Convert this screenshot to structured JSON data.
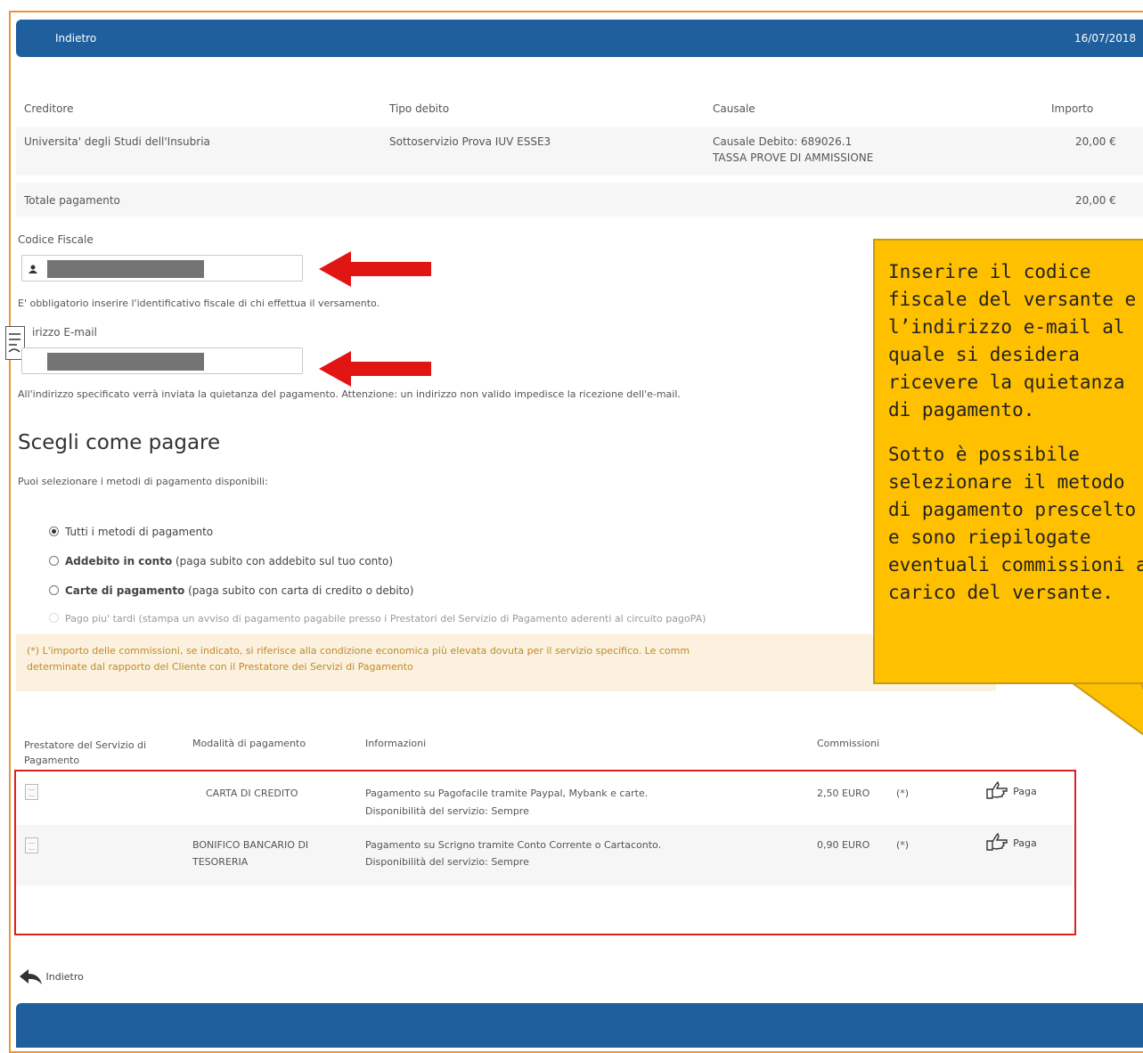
{
  "header": {
    "back_label": "Indietro",
    "date": "16/07/2018"
  },
  "debt_table": {
    "columns": [
      "Creditore",
      "Tipo debito",
      "Causale",
      "Importo"
    ],
    "row": {
      "creditor": "Universita' degli Studi dell'Insubria",
      "type": "Sottoservizio Prova IUV ESSE3",
      "causale_line1": "Causale Debito: 689026.1",
      "causale_line2": "TASSA PROVE DI AMMISSIONE",
      "amount": "20,00 €"
    },
    "total_label": "Totale pagamento",
    "total_amount": "20,00 €"
  },
  "form": {
    "fiscal_code_label": "Codice Fiscale",
    "fiscal_code_help": "E' obbligatorio inserire l'identificativo fiscale di chi effettua il versamento.",
    "email_label": "irizzo E-mail",
    "email_help": "All'indirizzo specificato verrà inviata la quietanza del pagamento. Attenzione: un indirizzo non valido impedisce la ricezione dell'e-mail."
  },
  "payment": {
    "title": "Scegli come pagare",
    "subtitle": "Puoi selezionare i metodi di pagamento disponibili:",
    "options": [
      {
        "bold": "Tutti i metodi di pagamento",
        "rest": "",
        "selected": true
      },
      {
        "bold": "Addebito in conto",
        "rest": " (paga subito con addebito sul tuo conto)",
        "selected": false
      },
      {
        "bold": "Carte di pagamento",
        "rest": " (paga subito con carta di credito o debito)",
        "selected": false
      },
      {
        "bold": "Pago piu' tardi",
        "rest": " (stampa un avviso di pagamento pagabile presso i Prestatori del Servizio di Pagamento aderenti al circuito pagoPA)",
        "selected": false
      }
    ],
    "note_line1": "(*) L'importo delle commissioni, se indicato, si riferisce alla condizione economica più elevata dovuta per il servizio specifico. Le comm",
    "note_line2": "determinate dal rapporto del Cliente con il Prestatore dei Servizi di Pagamento"
  },
  "methods_table": {
    "columns": [
      "Prestatore del Servizio di Pagamento",
      "Modalità di pagamento",
      "Informazioni",
      "Commissioni"
    ],
    "rows": [
      {
        "mode": "CARTA DI CREDITO",
        "info_line1": "Pagamento su Pagofacile tramite Paypal, Mybank e carte.",
        "info_line2": "Disponibilità del servizio: Sempre",
        "fee": "2,50 EURO",
        "fee_note": "(*)",
        "pay_label": "Paga"
      },
      {
        "mode_line1": "BONIFICO BANCARIO DI",
        "mode_line2": "TESORERIA",
        "info_line1": "Pagamento su Scrigno tramite Conto Corrente o Cartaconto.",
        "info_line2": "Disponibilità del servizio: Sempre",
        "fee": "0,90 EURO",
        "fee_note": "(*)",
        "pay_label": "Paga"
      }
    ]
  },
  "footer": {
    "back_label": "Indietro"
  },
  "callout": {
    "para1": "Inserire il codice fiscale del versante e l’indirizzo e-mail al quale si desidera ricevere la quietanza di pagamento.",
    "para2": "Sotto è possibile selezionare il metodo di pagamento prescelto e sono riepilogate eventuali commissioni a carico del versante."
  },
  "colors": {
    "header_blue": "#1f5f9e",
    "callout_yellow": "#ffc000",
    "highlight_red": "#dd1f22",
    "arrow_red": "#e21515"
  }
}
